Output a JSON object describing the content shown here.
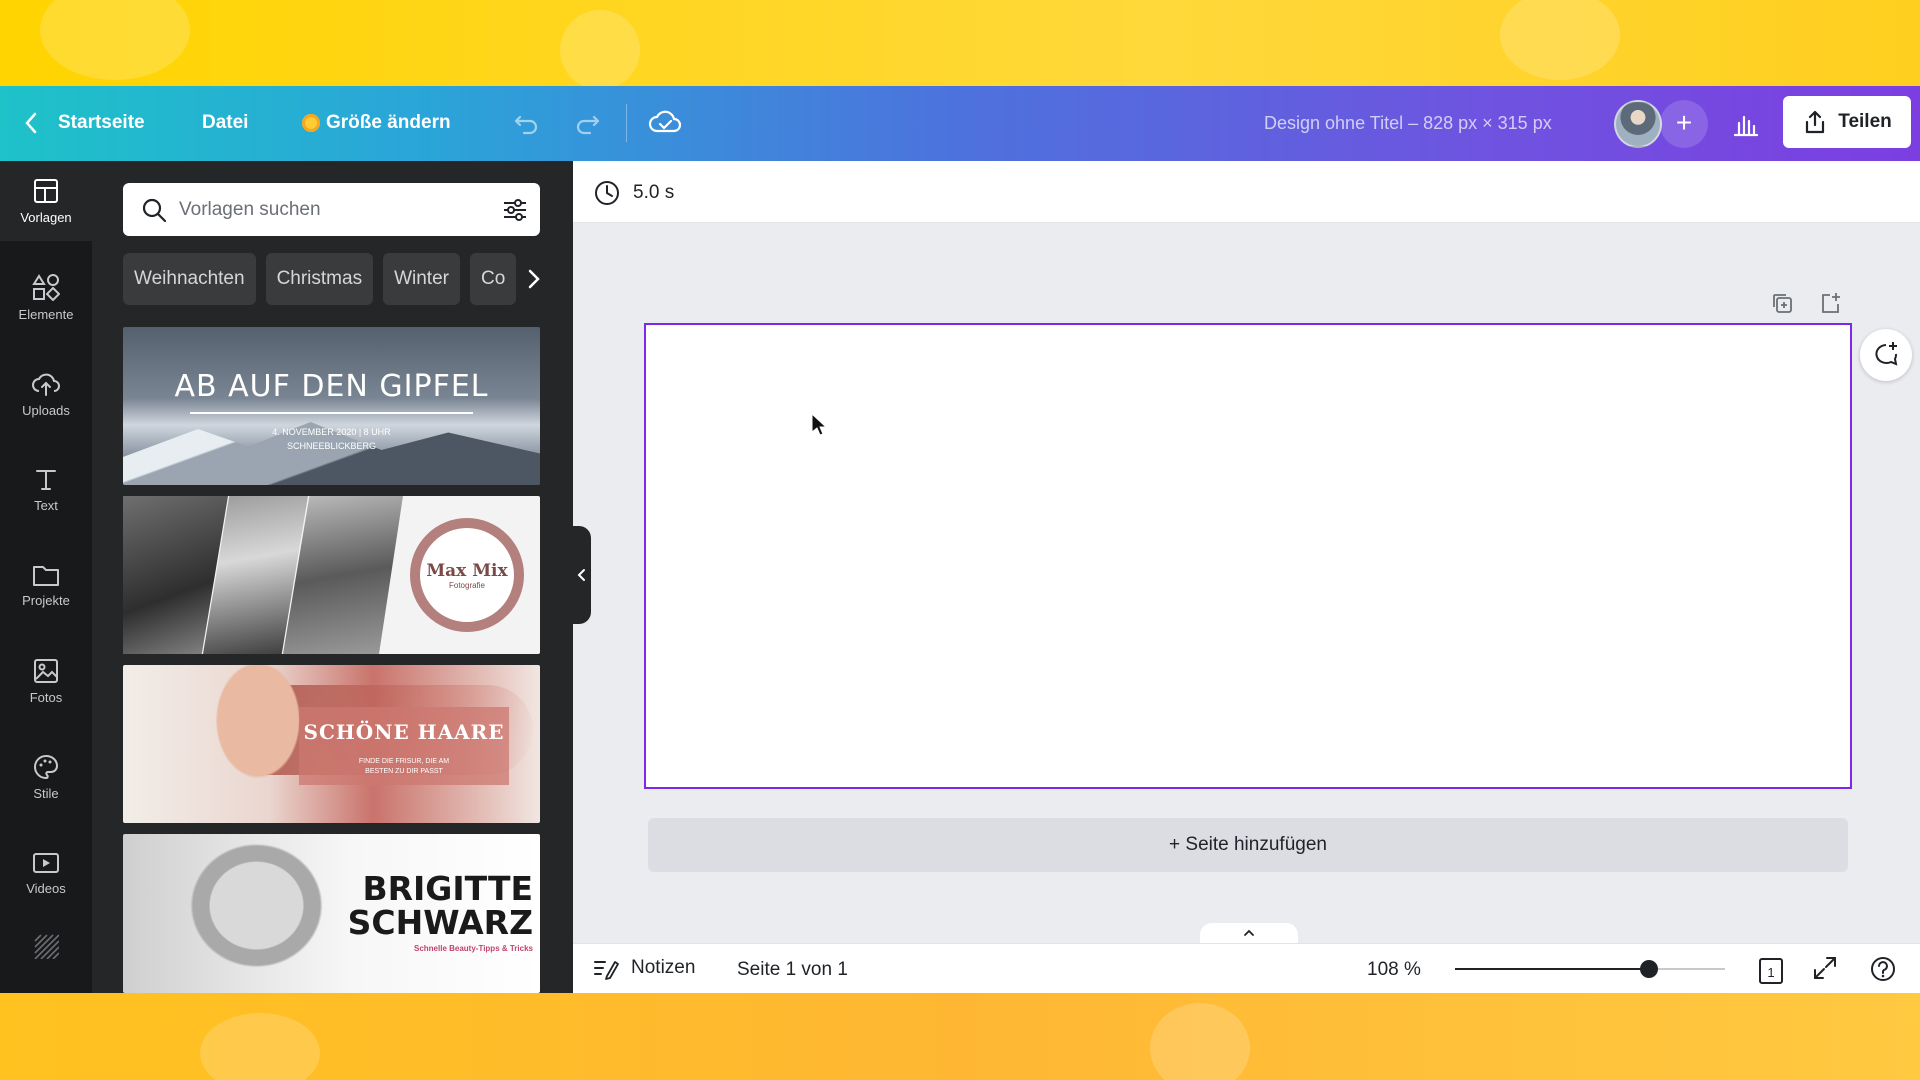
{
  "topbar": {
    "home_label": "Startseite",
    "file_label": "Datei",
    "resize_label": "Größe ändern",
    "design_title": "Design ohne Titel – 828 px × 315 px",
    "share_label": "Teilen"
  },
  "rail": {
    "items": [
      {
        "label": "Vorlagen",
        "icon": "templates-icon"
      },
      {
        "label": "Elemente",
        "icon": "elements-icon"
      },
      {
        "label": "Uploads",
        "icon": "upload-icon"
      },
      {
        "label": "Text",
        "icon": "text-icon"
      },
      {
        "label": "Projekte",
        "icon": "folder-icon"
      },
      {
        "label": "Fotos",
        "icon": "image-icon"
      },
      {
        "label": "Stile",
        "icon": "palette-icon"
      },
      {
        "label": "Videos",
        "icon": "video-icon"
      }
    ]
  },
  "panel": {
    "search_placeholder": "Vorlagen suchen",
    "chips": [
      "Weihnachten",
      "Christmas",
      "Winter",
      "Co"
    ],
    "templates": [
      {
        "title": "AB AUF DEN GIPFEL",
        "subtitle": "4. NOVEMBER 2020 | 8 UHR",
        "subtitle2": "SCHNEEBLICKBERG"
      },
      {
        "title": "Max Mix",
        "subtitle": "Fotografie"
      },
      {
        "title": "SCHÖNE HAARE",
        "subtitle": "FINDE DIE FRISUR, DIE AM",
        "subtitle2": "BESTEN ZU DIR PASST"
      },
      {
        "title": "BRIGITTE",
        "title2": "SCHWARZ",
        "subtitle": "Schnelle Beauty-Tipps & Tricks"
      }
    ]
  },
  "editor": {
    "duration": "5.0 s",
    "add_page_label": "+ Seite hinzufügen"
  },
  "footer": {
    "notes_label": "Notizen",
    "page_info": "Seite 1 von 1",
    "zoom_label": "108 %",
    "zoom_fraction": 0.72,
    "page_count": "1"
  },
  "colors": {
    "accent_purple": "#7d2ae8",
    "rail_bg": "#18191b",
    "panel_bg": "#252627"
  }
}
